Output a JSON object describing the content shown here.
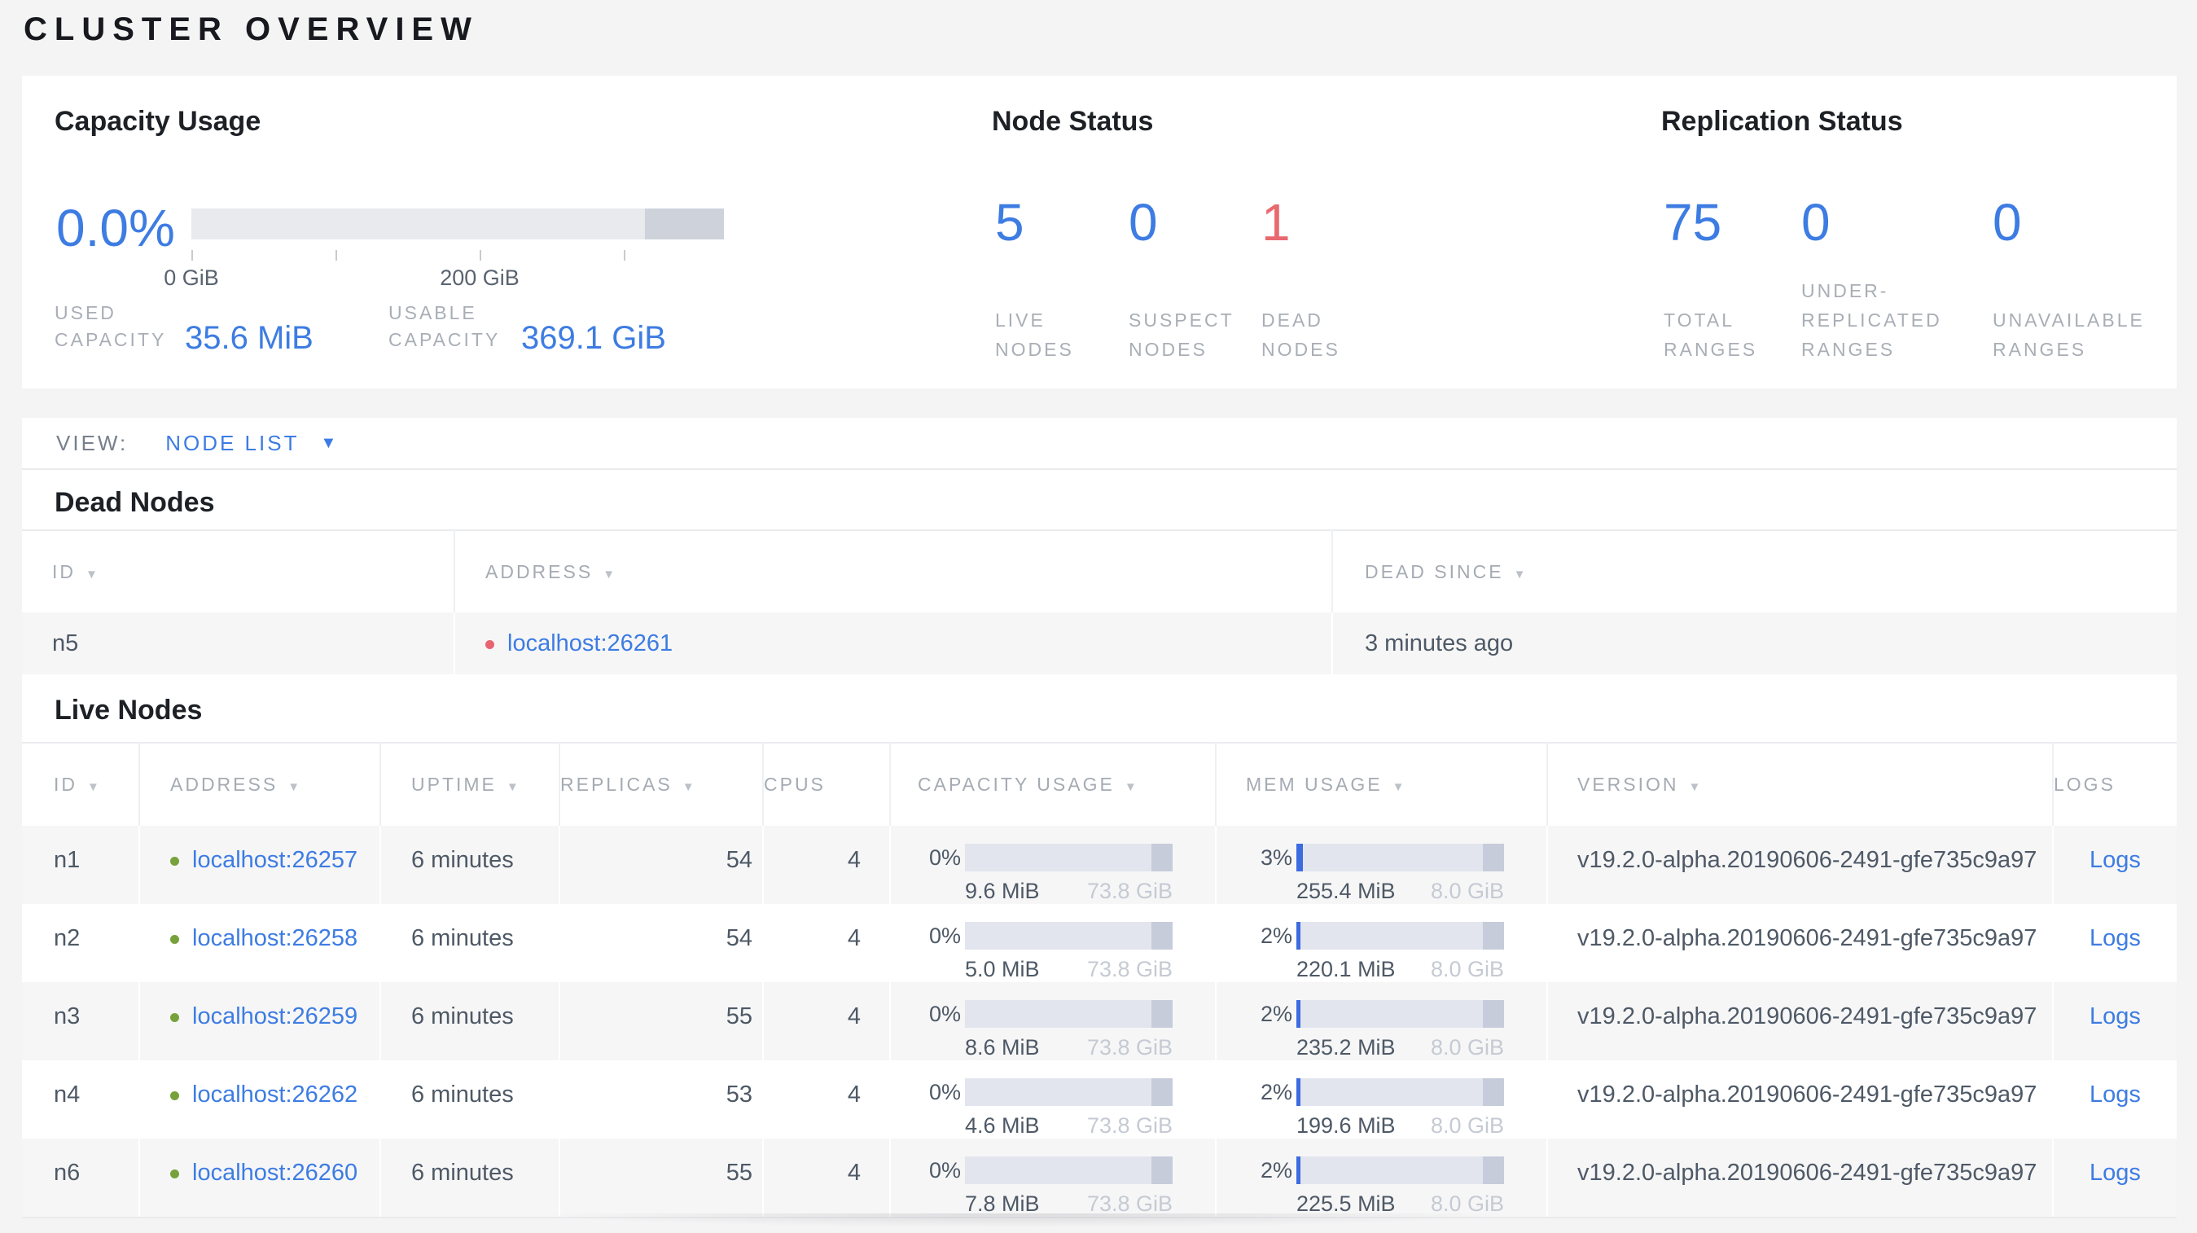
{
  "page": {
    "title": "CLUSTER OVERVIEW"
  },
  "icons": {
    "sort_desc": "▼",
    "dropdown": "▼"
  },
  "colors": {
    "accent_blue": "#3d7ce2",
    "alert_red": "#e8696f",
    "live_dot_green": "#77a23b",
    "dead_dot_red": "#e8656f"
  },
  "summary": {
    "capacity": {
      "title": "Capacity Usage",
      "percent": "0.0%",
      "axis_labels": [
        "0 GiB",
        "200 GiB"
      ],
      "stats": [
        {
          "label": "USED CAPACITY",
          "value": "35.6 MiB"
        },
        {
          "label": "USABLE CAPACITY",
          "value": "369.1 GiB"
        }
      ]
    },
    "node_status": {
      "title": "Node Status",
      "stats": [
        {
          "value": "5",
          "label": "LIVE NODES"
        },
        {
          "value": "0",
          "label": "SUSPECT NODES"
        },
        {
          "value": "1",
          "label": "DEAD NODES"
        }
      ]
    },
    "replication": {
      "title": "Replication Status",
      "stats": [
        {
          "value": "75",
          "label": "TOTAL RANGES"
        },
        {
          "value": "0",
          "label": "UNDER-REPLICATED RANGES"
        },
        {
          "value": "0",
          "label": "UNAVAILABLE RANGES"
        }
      ]
    }
  },
  "view_bar": {
    "label": "VIEW:",
    "selected": "NODE LIST"
  },
  "dead_nodes": {
    "title": "Dead Nodes",
    "columns": [
      "ID",
      "ADDRESS",
      "DEAD SINCE"
    ],
    "rows": [
      {
        "id": "n5",
        "address": "localhost:26261",
        "dead_since": "3 minutes ago"
      }
    ]
  },
  "live_nodes": {
    "title": "Live Nodes",
    "columns": [
      "ID",
      "ADDRESS",
      "UPTIME",
      "REPLICAS",
      "CPUS",
      "CAPACITY USAGE",
      "MEM USAGE",
      "VERSION",
      "LOGS"
    ],
    "rows": [
      {
        "id": "n1",
        "address": "localhost:26257",
        "uptime": "6 minutes",
        "replicas": "54",
        "cpus": "4",
        "capacity": {
          "percent": "0%",
          "used": "9.6 MiB",
          "total": "73.8 GiB",
          "fill_pct": 0
        },
        "mem": {
          "percent": "3%",
          "used": "255.4 MiB",
          "total": "8.0 GiB",
          "fill_pct": 3
        },
        "version": "v19.2.0-alpha.20190606-2491-gfe735c9a97",
        "logs": "Logs"
      },
      {
        "id": "n2",
        "address": "localhost:26258",
        "uptime": "6 minutes",
        "replicas": "54",
        "cpus": "4",
        "capacity": {
          "percent": "0%",
          "used": "5.0 MiB",
          "total": "73.8 GiB",
          "fill_pct": 0
        },
        "mem": {
          "percent": "2%",
          "used": "220.1 MiB",
          "total": "8.0 GiB",
          "fill_pct": 2
        },
        "version": "v19.2.0-alpha.20190606-2491-gfe735c9a97",
        "logs": "Logs"
      },
      {
        "id": "n3",
        "address": "localhost:26259",
        "uptime": "6 minutes",
        "replicas": "55",
        "cpus": "4",
        "capacity": {
          "percent": "0%",
          "used": "8.6 MiB",
          "total": "73.8 GiB",
          "fill_pct": 0
        },
        "mem": {
          "percent": "2%",
          "used": "235.2 MiB",
          "total": "8.0 GiB",
          "fill_pct": 2
        },
        "version": "v19.2.0-alpha.20190606-2491-gfe735c9a97",
        "logs": "Logs"
      },
      {
        "id": "n4",
        "address": "localhost:26262",
        "uptime": "6 minutes",
        "replicas": "53",
        "cpus": "4",
        "capacity": {
          "percent": "0%",
          "used": "4.6 MiB",
          "total": "73.8 GiB",
          "fill_pct": 0
        },
        "mem": {
          "percent": "2%",
          "used": "199.6 MiB",
          "total": "8.0 GiB",
          "fill_pct": 2
        },
        "version": "v19.2.0-alpha.20190606-2491-gfe735c9a97",
        "logs": "Logs"
      },
      {
        "id": "n6",
        "address": "localhost:26260",
        "uptime": "6 minutes",
        "replicas": "55",
        "cpus": "4",
        "capacity": {
          "percent": "0%",
          "used": "7.8 MiB",
          "total": "73.8 GiB",
          "fill_pct": 0
        },
        "mem": {
          "percent": "2%",
          "used": "225.5 MiB",
          "total": "8.0 GiB",
          "fill_pct": 2
        },
        "version": "v19.2.0-alpha.20190606-2491-gfe735c9a97",
        "logs": "Logs"
      }
    ]
  }
}
